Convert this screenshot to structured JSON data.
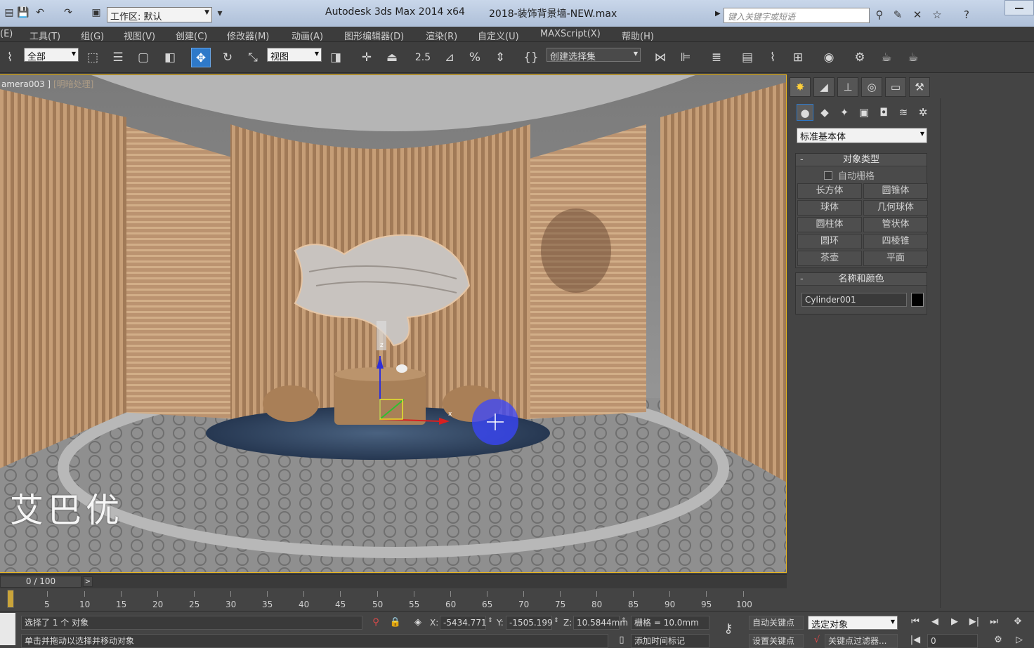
{
  "window": {
    "title_app": "Autodesk 3ds Max  2014 x64",
    "title_file": "2018-装饰背景墙-NEW.max",
    "workspace": "工作区: 默认",
    "search_placeholder": "键入关键字或短语"
  },
  "menu": [
    "(E)",
    "工具(T)",
    "组(G)",
    "视图(V)",
    "创建(C)",
    "修改器(M)",
    "动画(A)",
    "图形编辑器(D)",
    "渲染(R)",
    "自定义(U)",
    "MAXScript(X)",
    "帮助(H)"
  ],
  "toolbar": {
    "selection_filter": "全部",
    "coord_system": "视图",
    "snap_value": "2.5",
    "named_selection": "创建选择集"
  },
  "viewport": {
    "label": "amera003 ]",
    "label_mode": "[明暗处理]",
    "watermark": "艾巴优",
    "axis_x": "x",
    "axis_z": "z"
  },
  "command_panel": {
    "category_dropdown": "标准基本体",
    "object_type_title": "对象类型",
    "autogrid_label": "自动栅格",
    "objects": [
      "长方体",
      "圆锥体",
      "球体",
      "几何球体",
      "圆柱体",
      "管状体",
      "圆环",
      "四棱锥",
      "茶壶",
      "平面"
    ],
    "name_color_title": "名称和颜色",
    "object_name": "Cylinder001",
    "object_color": "#000000"
  },
  "timeline": {
    "frame_counter": "0 / 100",
    "ticks": [
      "5",
      "10",
      "15",
      "20",
      "25",
      "30",
      "35",
      "40",
      "45",
      "50",
      "55",
      "60",
      "65",
      "70",
      "75",
      "80",
      "85",
      "90",
      "95",
      "100"
    ]
  },
  "status": {
    "selection_text": "选择了 1 个 对象",
    "prompt_text": "单击并拖动以选择并移动对象",
    "x_label": "X:",
    "x_value": "-5434.771",
    "y_label": "Y:",
    "y_value": "-1505.199",
    "z_label": "Z:",
    "z_value": "10.5844mm",
    "grid_text": "栅格 = 10.0mm",
    "auto_key": "自动关键点",
    "set_key": "设置关键点",
    "key_mode_dropdown": "选定对象",
    "key_filter": "关键点过滤器...",
    "add_time_tag": "添加时间标记",
    "current_frame": "0"
  },
  "colors": {
    "accent_blue": "#2e79c9",
    "viewport_border": "#e7b623"
  }
}
